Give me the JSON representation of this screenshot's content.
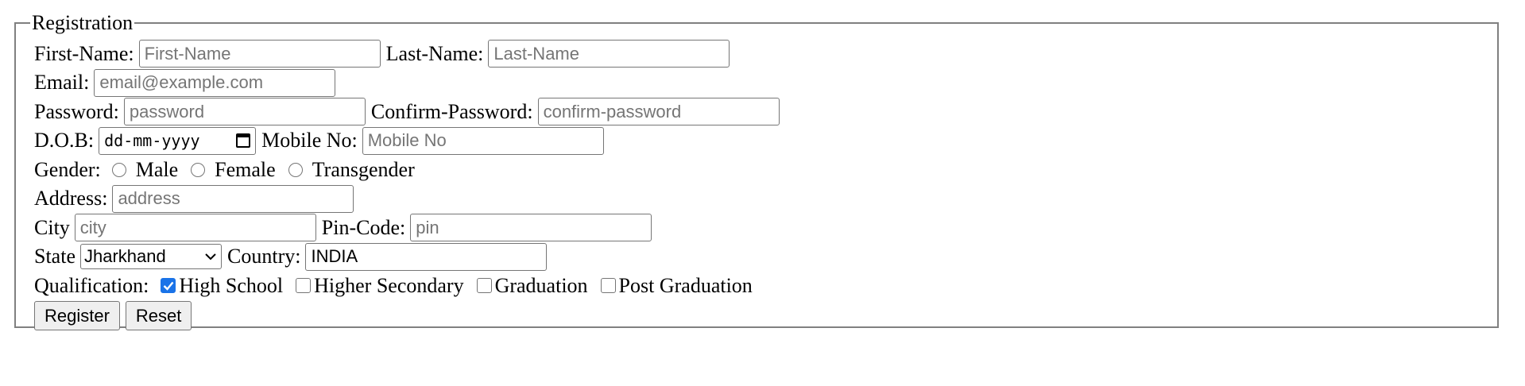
{
  "form": {
    "legend": "Registration",
    "first_name": {
      "label": "First-Name:",
      "placeholder": "First-Name"
    },
    "last_name": {
      "label": "Last-Name:",
      "placeholder": "Last-Name"
    },
    "email": {
      "label": "Email:",
      "placeholder": "email@example.com"
    },
    "password": {
      "label": "Password:",
      "placeholder": "password"
    },
    "confirm_password": {
      "label": "Confirm-Password:",
      "placeholder": "confirm-password"
    },
    "dob": {
      "label": "D.O.B:",
      "value": "dd-mm-yyyy",
      "icon": "calendar-icon"
    },
    "mobile": {
      "label": "Mobile No:",
      "placeholder": "Mobile No"
    },
    "gender": {
      "label": "Gender:",
      "options": [
        "Male",
        "Female",
        "Transgender"
      ]
    },
    "address": {
      "label": "Address:",
      "placeholder": "address"
    },
    "city": {
      "label": "City",
      "placeholder": "city"
    },
    "pin": {
      "label": "Pin-Code:",
      "placeholder": "pin"
    },
    "state": {
      "label": "State",
      "selected": "Jharkhand",
      "icon": "chevron-down-icon"
    },
    "country": {
      "label": "Country:",
      "value": "INDIA"
    },
    "qualification": {
      "label": "Qualification:",
      "options": [
        {
          "label": "High School",
          "checked": true
        },
        {
          "label": "Higher Secondary",
          "checked": false
        },
        {
          "label": "Graduation",
          "checked": false
        },
        {
          "label": "Post Graduation",
          "checked": false
        }
      ]
    },
    "buttons": {
      "register": "Register",
      "reset": "Reset"
    },
    "colors": {
      "checkbox_checked": "#1a73e8",
      "border": "#808080"
    }
  }
}
